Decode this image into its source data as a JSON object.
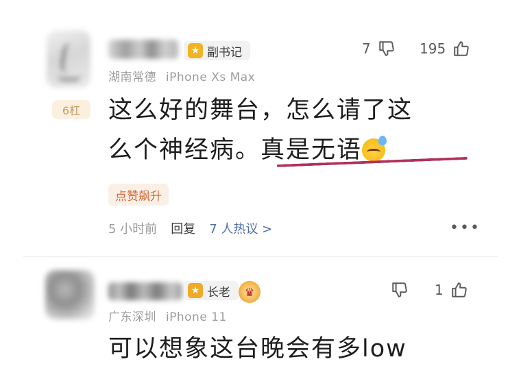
{
  "comments": [
    {
      "badge": {
        "label": "副书记",
        "icon": "star-shield-icon",
        "color": "#f2b322"
      },
      "location": "湖南常德",
      "device": "iPhone Xs Max",
      "dislikes": "7",
      "likes": "195",
      "floor_tag": "6杠",
      "content_line1": "这么好的舞台，怎么请了这",
      "content_line2_a": "么个神经病。",
      "content_line2_b": "真是无语",
      "emoji": "sweat-sad-face",
      "hot_tag": "点赞飙升",
      "time": "5 小时前",
      "reply_label": "回复",
      "replies_label": "7 人热议 >",
      "more": "•••"
    },
    {
      "badge": {
        "label": "长老",
        "icon": "star-shield-icon",
        "color": "#f0a928"
      },
      "crest_text": "♛",
      "location": "广东深圳",
      "device": "iPhone 11",
      "dislikes": "",
      "likes": "1",
      "content_line1": "可以想象这台晚会有多low"
    }
  ],
  "colors": {
    "underline": "#b0315a",
    "reply_link": "#4f6fa6",
    "hot_tag_text": "#d46a3a",
    "floor_tag_text": "#c79a63"
  }
}
